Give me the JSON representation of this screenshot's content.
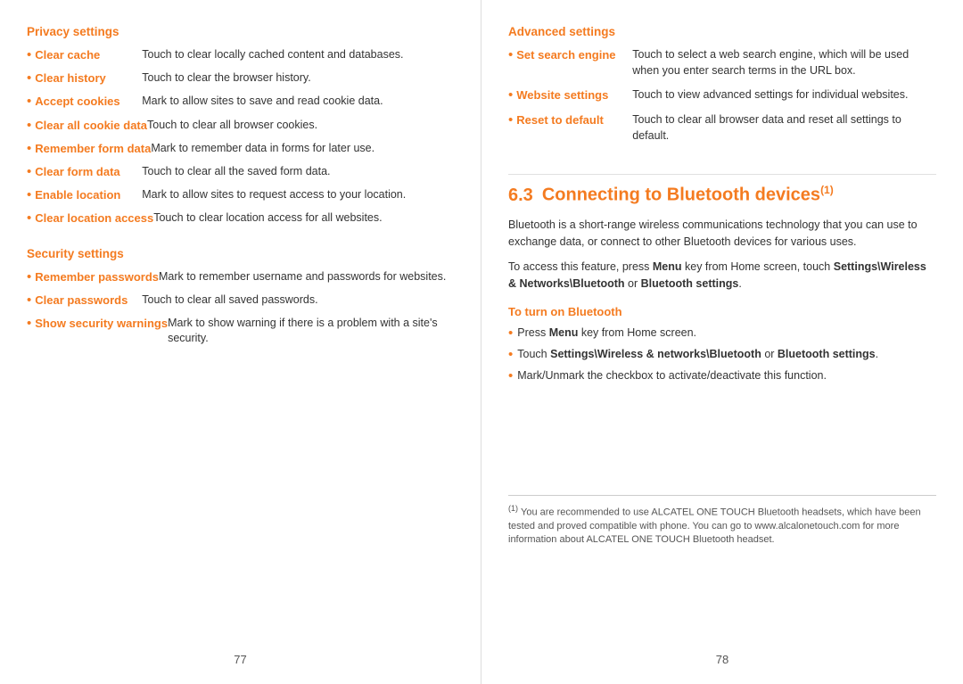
{
  "left": {
    "privacy_heading": "Privacy settings",
    "privacy_items": [
      {
        "term": "Clear cache",
        "desc": "Touch to clear locally cached content and databases."
      },
      {
        "term": "Clear history",
        "desc": "Touch to clear the browser history."
      },
      {
        "term": "Accept cookies",
        "desc": "Mark to allow sites to save and read cookie data."
      },
      {
        "term": "Clear all cookie data",
        "desc": "Touch to clear all browser cookies."
      },
      {
        "term": "Remember form data",
        "desc": "Mark to remember data in forms for later use."
      },
      {
        "term": "Clear form data",
        "desc": "Touch to clear all the saved form data."
      },
      {
        "term": "Enable location",
        "desc": "Mark to allow sites to request access to your location."
      },
      {
        "term": "Clear location access",
        "desc": "Touch to clear location access for all websites."
      }
    ],
    "security_heading": "Security settings",
    "security_items": [
      {
        "term": "Remember passwords",
        "desc": "Mark to remember username and passwords for websites."
      },
      {
        "term": "Clear passwords",
        "desc": "Touch to clear all saved passwords."
      },
      {
        "term": "Show security warnings",
        "desc": "Mark to show warning if there is a problem with a site's security."
      }
    ],
    "page_number": "77"
  },
  "right": {
    "advanced_heading": "Advanced settings",
    "advanced_items": [
      {
        "term": "Set search engine",
        "desc": "Touch to select a web search engine, which will be used when you enter search terms in the URL box."
      },
      {
        "term": "Website settings",
        "desc": "Touch to view advanced settings for individual websites."
      },
      {
        "term": "Reset to default",
        "desc": "Touch to clear all browser data and reset all settings to default."
      }
    ],
    "chapter_number": "6.3",
    "chapter_title": "Connecting to Bluetooth devices",
    "chapter_sup": "(1)",
    "intro_text": "Bluetooth is a short-range wireless communications technology that you can use to exchange data, or connect to other Bluetooth devices for various uses.",
    "access_text_1": "To access this feature, press ",
    "access_bold_1": "Menu",
    "access_text_2": " key from Home screen, touch ",
    "access_bold_2": "Settings\\",
    "access_bold_3": "Wireless & Networks\\Bluetooth",
    "access_text_3": " or ",
    "access_bold_4": "Bluetooth settings",
    "access_text_4": ".",
    "bluetooth_heading": "To turn on Bluetooth",
    "bluetooth_items": [
      {
        "text_1": "Press ",
        "bold_1": "Menu",
        "text_2": " key from Home screen."
      },
      {
        "text_1": "Touch ",
        "bold_1": "Settings\\Wireless & networks\\Bluetooth",
        "text_2": " or ",
        "bold_2": "Bluetooth settings",
        "text_3": "."
      },
      {
        "text_1": "Mark/Unmark the checkbox to activate/deactivate this function."
      }
    ],
    "footnote_num": "(1)",
    "footnote_text": "You are recommended to use ALCATEL ONE TOUCH Bluetooth headsets, which have been tested and proved compatible with phone. You can go to www.alcalonetouch.com for more information about ALCATEL ONE TOUCH Bluetooth headset.",
    "page_number": "78"
  }
}
